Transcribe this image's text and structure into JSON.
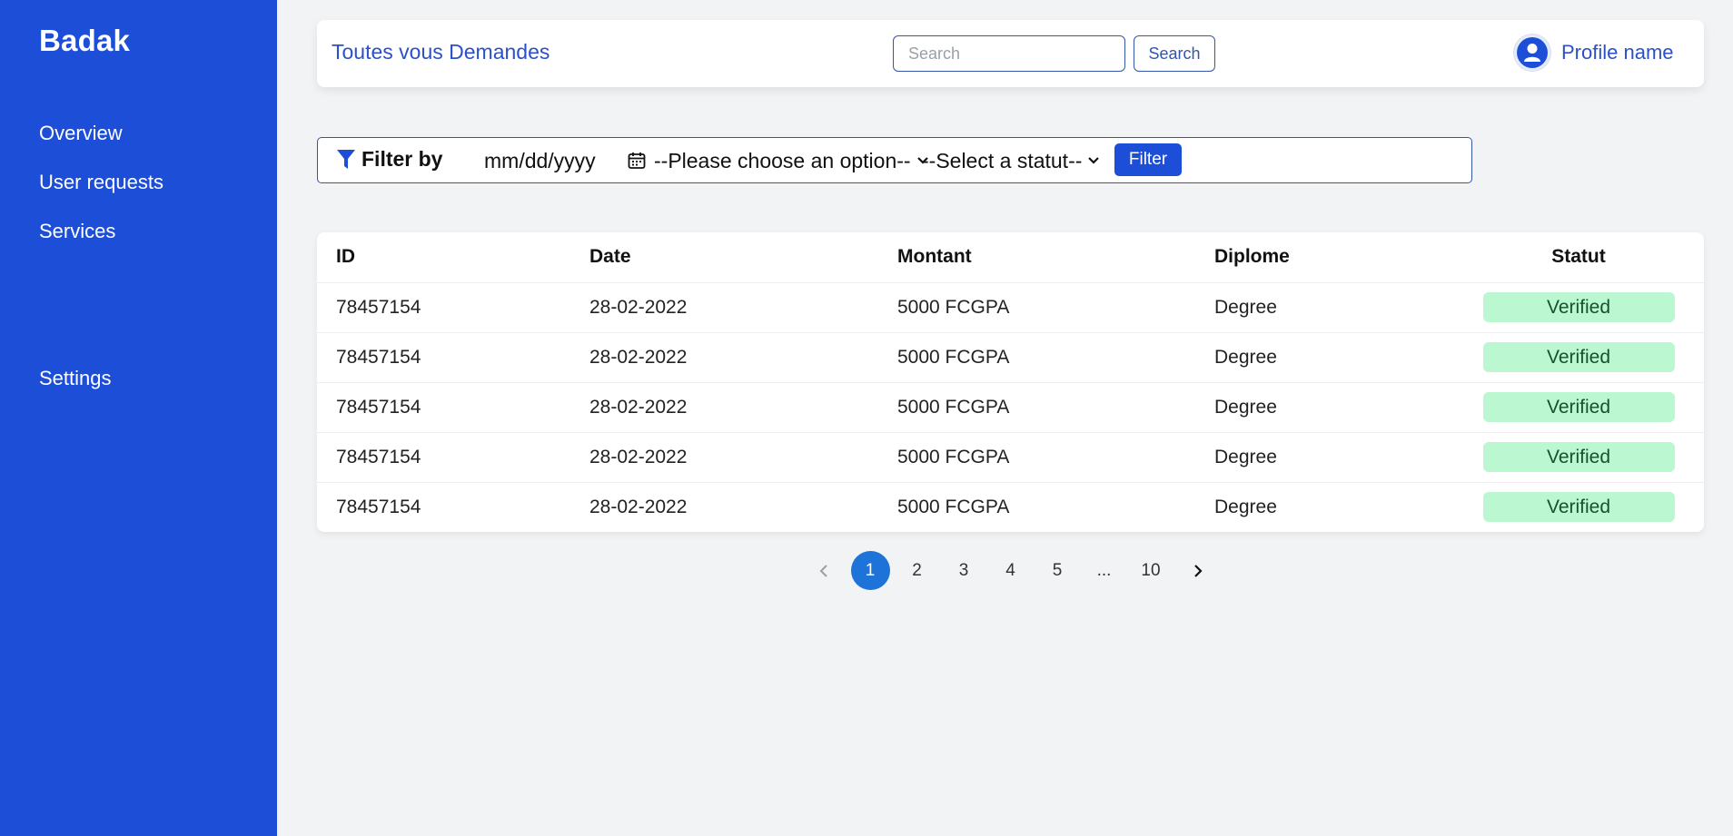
{
  "sidebar": {
    "brand": "Badak",
    "nav": {
      "overview": "Overview",
      "user_requests": "User requests",
      "services": "Services",
      "settings": "Settings"
    }
  },
  "header": {
    "title": "Toutes vous Demandes",
    "search_placeholder": "Search",
    "search_button": "Search",
    "profile_name": "Profile name"
  },
  "filter": {
    "label": "Filter by",
    "date_placeholder": "mm/dd/yyyy",
    "option_select": "--Please choose an option--",
    "status_select": "--Select a statut--",
    "button": "Filter"
  },
  "table": {
    "headers": [
      "ID",
      "Date",
      "Montant",
      "Diplome",
      "Statut"
    ],
    "rows": [
      [
        "78457154",
        "28-02-2022",
        "5000 FCGPA",
        "Degree",
        "Verified"
      ],
      [
        "78457154",
        "28-02-2022",
        "5000 FCGPA",
        "Degree",
        "Verified"
      ],
      [
        "78457154",
        "28-02-2022",
        "5000 FCGPA",
        "Degree",
        "Verified"
      ],
      [
        "78457154",
        "28-02-2022",
        "5000 FCGPA",
        "Degree",
        "Verified"
      ],
      [
        "78457154",
        "28-02-2022",
        "5000 FCGPA",
        "Degree",
        "Verified"
      ]
    ]
  },
  "pagination": {
    "pages": [
      "1",
      "2",
      "3",
      "4",
      "5",
      "...",
      "10"
    ],
    "current": "1"
  },
  "colors": {
    "sidebar_bg": "#1d4ed8",
    "accent_text": "#2b50c8",
    "badge_bg": "#bbf7d0",
    "active_page": "#1d73d8"
  }
}
